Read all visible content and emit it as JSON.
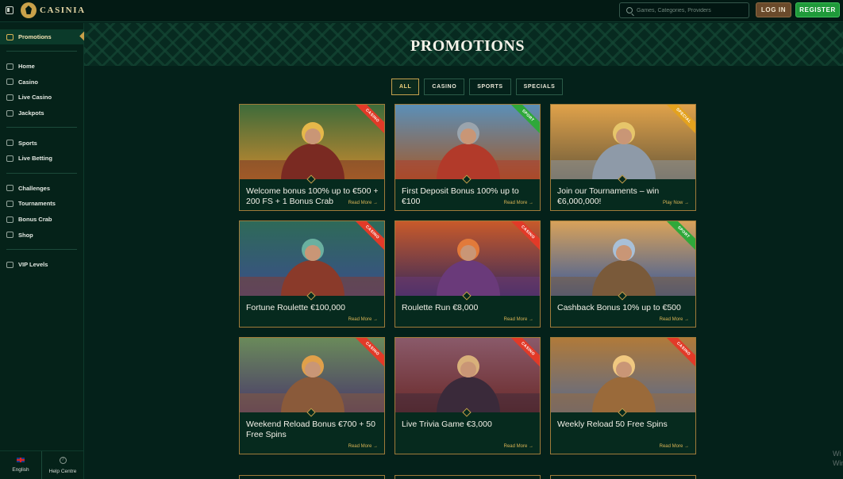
{
  "topbar": {
    "logo_text": "CASINIA",
    "search_placeholder": "Games, Categories, Providers",
    "login_label": "LOG IN",
    "register_label": "REGISTER"
  },
  "sidebar": {
    "active_item": "Promotions",
    "groups": [
      [
        "Home",
        "Casino",
        "Live Casino",
        "Jackpots"
      ],
      [
        "Sports",
        "Live Betting"
      ],
      [
        "Challenges",
        "Tournaments",
        "Bonus Crab",
        "Shop"
      ],
      [
        "VIP Levels"
      ]
    ],
    "footer": {
      "language": "English",
      "help": "Help Centre"
    }
  },
  "main": {
    "title": "PROMOTIONS",
    "filters": [
      "ALL",
      "CASINO",
      "SPORTS",
      "SPECIALS"
    ],
    "active_filter": "ALL"
  },
  "colors": {
    "casino": "#e23a28",
    "sport": "#2fa83a",
    "special": "#e4a21e",
    "gold": "#c9a04a"
  },
  "promotions": [
    {
      "title": "Welcome bonus 100% up to €500 + 200 FS + 1 Bonus Crab",
      "badge": "CASINO",
      "link": "Read More →"
    },
    {
      "title": "First Deposit Bonus 100% up to €100",
      "badge": "SPORT",
      "link": "Read More →"
    },
    {
      "title": "Join our Tournaments – win €6,000,000!",
      "badge": "SPECIAL",
      "link": "Play Now →"
    },
    {
      "title": "Fortune Roulette €100,000",
      "badge": "CASINO",
      "link": "Read More →"
    },
    {
      "title": "Roulette Run €8,000",
      "badge": "CASINO",
      "link": "Read More →"
    },
    {
      "title": "Cashback Bonus 10% up to €500",
      "badge": "SPORT",
      "link": "Read More →"
    },
    {
      "title": "Weekend Reload Bonus €700 + 50 Free Spins",
      "badge": "CASINO",
      "link": "Read More →"
    },
    {
      "title": "Live Trivia Game €3,000",
      "badge": "CASINO",
      "link": "Read More →"
    },
    {
      "title": "Weekly Reload 50 Free Spins",
      "badge": "CASINO",
      "link": "Read More →"
    }
  ],
  "watermark": {
    "line1": "Wi",
    "line2": "Win"
  }
}
